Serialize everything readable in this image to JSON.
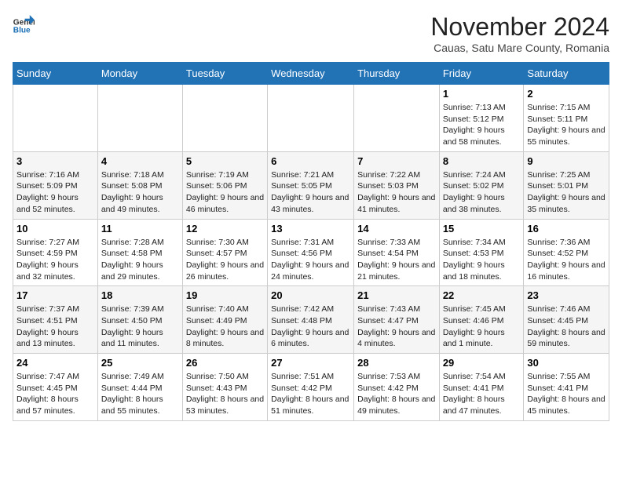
{
  "logo": {
    "general": "General",
    "blue": "Blue"
  },
  "title": "November 2024",
  "subtitle": "Cauas, Satu Mare County, Romania",
  "columns": [
    "Sunday",
    "Monday",
    "Tuesday",
    "Wednesday",
    "Thursday",
    "Friday",
    "Saturday"
  ],
  "weeks": [
    [
      {
        "day": "",
        "info": ""
      },
      {
        "day": "",
        "info": ""
      },
      {
        "day": "",
        "info": ""
      },
      {
        "day": "",
        "info": ""
      },
      {
        "day": "",
        "info": ""
      },
      {
        "day": "1",
        "info": "Sunrise: 7:13 AM\nSunset: 5:12 PM\nDaylight: 9 hours and 58 minutes."
      },
      {
        "day": "2",
        "info": "Sunrise: 7:15 AM\nSunset: 5:11 PM\nDaylight: 9 hours and 55 minutes."
      }
    ],
    [
      {
        "day": "3",
        "info": "Sunrise: 7:16 AM\nSunset: 5:09 PM\nDaylight: 9 hours and 52 minutes."
      },
      {
        "day": "4",
        "info": "Sunrise: 7:18 AM\nSunset: 5:08 PM\nDaylight: 9 hours and 49 minutes."
      },
      {
        "day": "5",
        "info": "Sunrise: 7:19 AM\nSunset: 5:06 PM\nDaylight: 9 hours and 46 minutes."
      },
      {
        "day": "6",
        "info": "Sunrise: 7:21 AM\nSunset: 5:05 PM\nDaylight: 9 hours and 43 minutes."
      },
      {
        "day": "7",
        "info": "Sunrise: 7:22 AM\nSunset: 5:03 PM\nDaylight: 9 hours and 41 minutes."
      },
      {
        "day": "8",
        "info": "Sunrise: 7:24 AM\nSunset: 5:02 PM\nDaylight: 9 hours and 38 minutes."
      },
      {
        "day": "9",
        "info": "Sunrise: 7:25 AM\nSunset: 5:01 PM\nDaylight: 9 hours and 35 minutes."
      }
    ],
    [
      {
        "day": "10",
        "info": "Sunrise: 7:27 AM\nSunset: 4:59 PM\nDaylight: 9 hours and 32 minutes."
      },
      {
        "day": "11",
        "info": "Sunrise: 7:28 AM\nSunset: 4:58 PM\nDaylight: 9 hours and 29 minutes."
      },
      {
        "day": "12",
        "info": "Sunrise: 7:30 AM\nSunset: 4:57 PM\nDaylight: 9 hours and 26 minutes."
      },
      {
        "day": "13",
        "info": "Sunrise: 7:31 AM\nSunset: 4:56 PM\nDaylight: 9 hours and 24 minutes."
      },
      {
        "day": "14",
        "info": "Sunrise: 7:33 AM\nSunset: 4:54 PM\nDaylight: 9 hours and 21 minutes."
      },
      {
        "day": "15",
        "info": "Sunrise: 7:34 AM\nSunset: 4:53 PM\nDaylight: 9 hours and 18 minutes."
      },
      {
        "day": "16",
        "info": "Sunrise: 7:36 AM\nSunset: 4:52 PM\nDaylight: 9 hours and 16 minutes."
      }
    ],
    [
      {
        "day": "17",
        "info": "Sunrise: 7:37 AM\nSunset: 4:51 PM\nDaylight: 9 hours and 13 minutes."
      },
      {
        "day": "18",
        "info": "Sunrise: 7:39 AM\nSunset: 4:50 PM\nDaylight: 9 hours and 11 minutes."
      },
      {
        "day": "19",
        "info": "Sunrise: 7:40 AM\nSunset: 4:49 PM\nDaylight: 9 hours and 8 minutes."
      },
      {
        "day": "20",
        "info": "Sunrise: 7:42 AM\nSunset: 4:48 PM\nDaylight: 9 hours and 6 minutes."
      },
      {
        "day": "21",
        "info": "Sunrise: 7:43 AM\nSunset: 4:47 PM\nDaylight: 9 hours and 4 minutes."
      },
      {
        "day": "22",
        "info": "Sunrise: 7:45 AM\nSunset: 4:46 PM\nDaylight: 9 hours and 1 minute."
      },
      {
        "day": "23",
        "info": "Sunrise: 7:46 AM\nSunset: 4:45 PM\nDaylight: 8 hours and 59 minutes."
      }
    ],
    [
      {
        "day": "24",
        "info": "Sunrise: 7:47 AM\nSunset: 4:45 PM\nDaylight: 8 hours and 57 minutes."
      },
      {
        "day": "25",
        "info": "Sunrise: 7:49 AM\nSunset: 4:44 PM\nDaylight: 8 hours and 55 minutes."
      },
      {
        "day": "26",
        "info": "Sunrise: 7:50 AM\nSunset: 4:43 PM\nDaylight: 8 hours and 53 minutes."
      },
      {
        "day": "27",
        "info": "Sunrise: 7:51 AM\nSunset: 4:42 PM\nDaylight: 8 hours and 51 minutes."
      },
      {
        "day": "28",
        "info": "Sunrise: 7:53 AM\nSunset: 4:42 PM\nDaylight: 8 hours and 49 minutes."
      },
      {
        "day": "29",
        "info": "Sunrise: 7:54 AM\nSunset: 4:41 PM\nDaylight: 8 hours and 47 minutes."
      },
      {
        "day": "30",
        "info": "Sunrise: 7:55 AM\nSunset: 4:41 PM\nDaylight: 8 hours and 45 minutes."
      }
    ]
  ]
}
